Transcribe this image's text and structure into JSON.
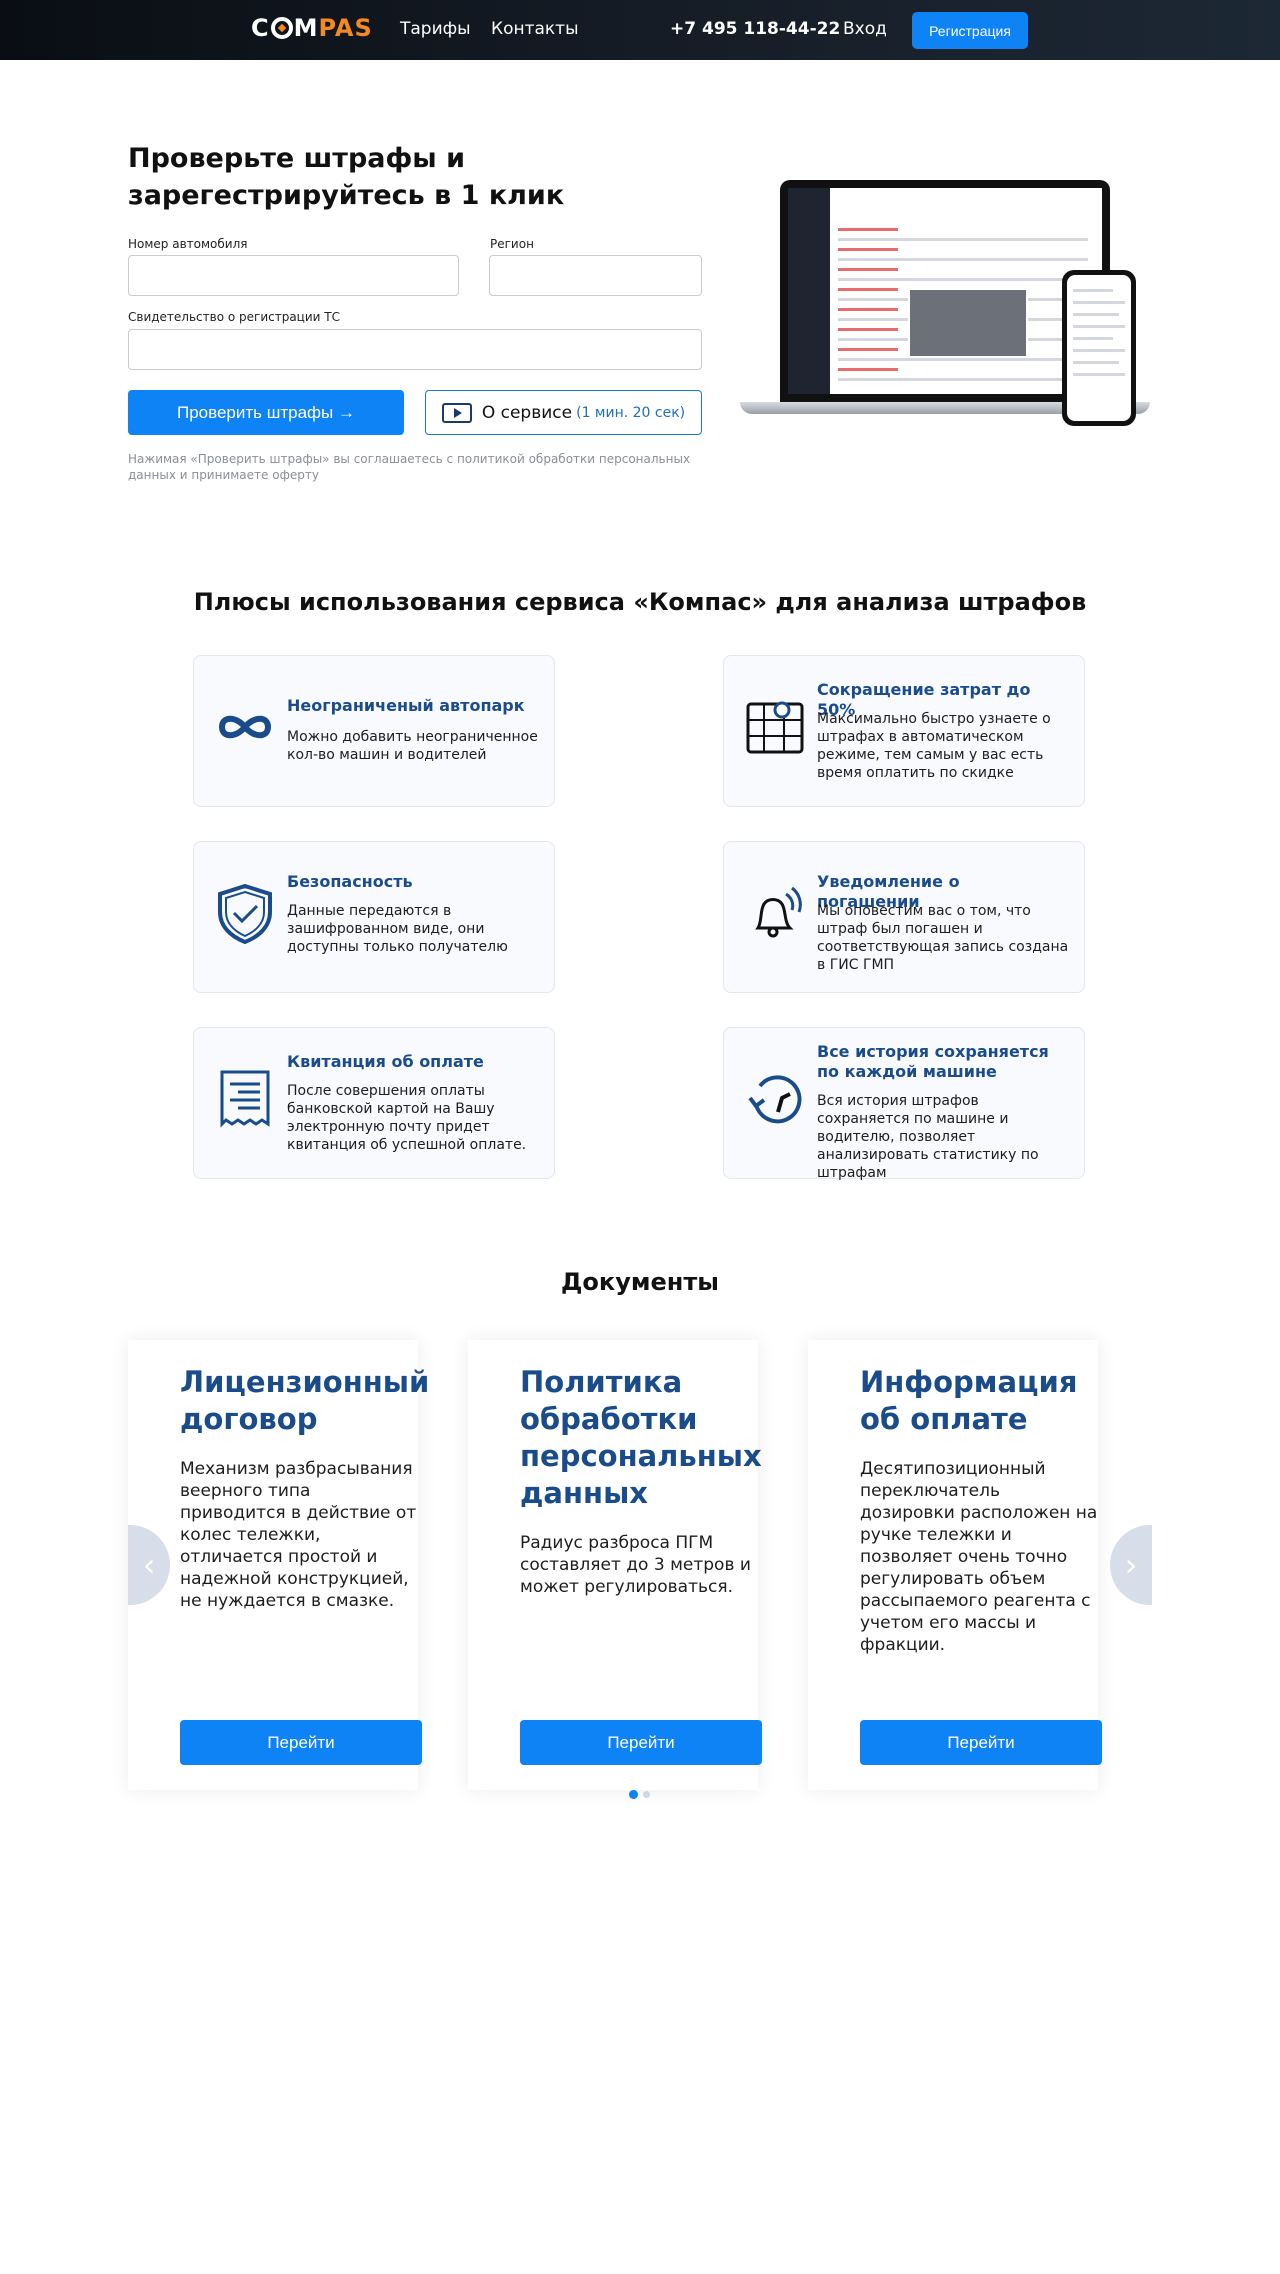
{
  "header": {
    "logo_left": "C",
    "logo_mid": "M",
    "logo_right": "PAS",
    "nav": [
      "Тарифы",
      "Контакты"
    ],
    "phone": "+7 495 118-44-22",
    "login": "Вход",
    "register": "Регистрация"
  },
  "hero": {
    "title": "Проверьте штрафы и зарегестрируйтесь в 1 клик",
    "car_number_label": "Номер автомобиля",
    "region_label": "Регион",
    "certificate_label": "Свидетельство о регистрации ТС",
    "car_number_value": "",
    "region_value": "",
    "certificate_value": "",
    "check_button": "Проверить штрафы →",
    "about_button": "О сервисе",
    "about_duration": "(1 мин. 20 сек)",
    "disclaimer": "Нажимая «Проверить штрафы» вы соглашаетесь с политикой обработки персональных данных и принимаете оферту"
  },
  "benefits": {
    "title": "Плюсы использования сервиса «Компас» для анализа штрафов",
    "items": [
      {
        "icon": "infinity-icon",
        "title": "Неограниченый автопарк",
        "text": "Можно добавить неограниченное кол-во машин и водителей"
      },
      {
        "icon": "map-pin-icon",
        "title": "Сокращение затрат до 50%",
        "text": "Максимально быстро узнаете о штрафах в автоматическом режиме, тем самым у вас есть время оплатить по скидке"
      },
      {
        "icon": "shield-check-icon",
        "title": "Безопасность",
        "text": "Данные передаются в зашифрованном виде, они доступны только получателю"
      },
      {
        "icon": "bell-icon",
        "title": "Уведомление о погашении",
        "text": "Мы оповестим вас о том, что штраф был погашен и соответствующая запись создана в ГИС ГМП"
      },
      {
        "icon": "receipt-icon",
        "title": "Квитанция об оплате",
        "text": "После совершения оплаты банковской картой на Вашу электронную почту придет квитанция об успешной оплате."
      },
      {
        "icon": "history-icon",
        "title": "Все история сохраняется по каждой машине",
        "text": "Вся история штрафов сохраняется по машине и водителю, позволяет анализировать статистику по штрафам"
      }
    ]
  },
  "documents": {
    "title": "Документы",
    "items": [
      {
        "title": "Лицензионный договор",
        "text": "Механизм разбрасывания веерного типа приводится в действие от колес тележки, отличается простой и надежной конструкцией, не нуждается в смазке.",
        "button": "Перейти"
      },
      {
        "title": "Политика обработки персональных данных",
        "text": "Радиус разброса ПГМ составляет до 3 метров и может регулироваться.",
        "button": "Перейти"
      },
      {
        "title": "Информация об оплате",
        "text": "Десятипозиционный переключатель дозировки расположен на ручке тележки и позволяет очень точно регулировать объем рассыпаемого реагента с учетом его массы и фракции.",
        "button": "Перейти"
      }
    ],
    "active_page": 1,
    "pages": 2
  },
  "colors": {
    "accent": "#0d83f5",
    "brand_orange": "#f48a1f",
    "heading_blue": "#1a4c8b",
    "header_bg": "#0a0e14"
  }
}
